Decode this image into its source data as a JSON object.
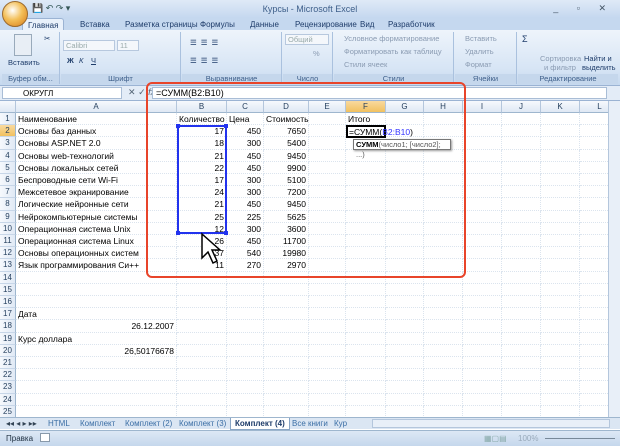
{
  "window": {
    "title": "Курсы - Microsoft Excel"
  },
  "ribbon_tabs": [
    "Главная",
    "Вставка",
    "Разметка страницы",
    "Формулы",
    "Данные",
    "Рецензирование",
    "Вид",
    "Разработчик"
  ],
  "ribbon": {
    "clipboard": {
      "paste": "Вставить",
      "label": "Буфер обм..."
    },
    "font": {
      "name": "Calibri",
      "size": "11",
      "bold": "Ж",
      "italic": "К",
      "underline": "Ч",
      "label": "Шрифт"
    },
    "alignment": {
      "label": "Выравнивание"
    },
    "number": {
      "format": "Общий",
      "percent": "%",
      "thousands": "000",
      "label": "Число"
    },
    "styles": {
      "conditional": "Условное форматирование",
      "as_table": "Форматировать как таблицу",
      "cell_styles": "Стили ячеек",
      "label": "Стили"
    },
    "cells": {
      "insert": "Вставить",
      "delete": "Удалить",
      "format": "Формат",
      "label": "Ячейки"
    },
    "editing": {
      "sigma": "Σ",
      "sort1": "Сортировка",
      "sort2": "и фильтр",
      "find1": "Найти и",
      "find2": "выделить",
      "label": "Редактирование"
    }
  },
  "formula_bar": {
    "name_box": "ОКРУГЛ",
    "cancel": "✕",
    "enter": "✓",
    "fx": "fx",
    "formula": "=СУММ(B2:B10)"
  },
  "columns": [
    "A",
    "B",
    "C",
    "D",
    "E",
    "F",
    "G",
    "H",
    "I",
    "J",
    "K",
    "L"
  ],
  "selected_column": "F",
  "selected_row": 2,
  "rows": [
    {
      "n": 1,
      "A": "Наименование",
      "B": "Количество",
      "C": "Цена",
      "D": "Стоимость",
      "F": "Итого"
    },
    {
      "n": 2,
      "A": "Основы баз данных",
      "B": "17",
      "C": "450",
      "D": "7650"
    },
    {
      "n": 3,
      "A": "Основы ASP.NET 2.0",
      "B": "18",
      "C": "300",
      "D": "5400"
    },
    {
      "n": 4,
      "A": "Основы web-технологий",
      "B": "21",
      "C": "450",
      "D": "9450"
    },
    {
      "n": 5,
      "A": "Основы локальных сетей",
      "B": "22",
      "C": "450",
      "D": "9900"
    },
    {
      "n": 6,
      "A": "Беспроводные сети Wi-Fi",
      "B": "17",
      "C": "300",
      "D": "5100"
    },
    {
      "n": 7,
      "A": "Межсетевое экранирование",
      "B": "24",
      "C": "300",
      "D": "7200"
    },
    {
      "n": 8,
      "A": "Логические нейронные сети",
      "B": "21",
      "C": "450",
      "D": "9450"
    },
    {
      "n": 9,
      "A": "Нейрокомпьютерные системы",
      "B": "25",
      "C": "225",
      "D": "5625"
    },
    {
      "n": 10,
      "A": "Операционная система Unix",
      "B": "12",
      "C": "300",
      "D": "3600"
    },
    {
      "n": 11,
      "A": "Операционная система Linux",
      "B": "26",
      "C": "450",
      "D": "11700"
    },
    {
      "n": 12,
      "A": "Основы операционных систем",
      "B": "37",
      "C": "540",
      "D": "19980"
    },
    {
      "n": 13,
      "A": "Язык программирования Си++",
      "B": "11",
      "C": "270",
      "D": "2970"
    },
    {
      "n": 14
    },
    {
      "n": 15
    },
    {
      "n": 16
    },
    {
      "n": 17,
      "A": "Дата"
    },
    {
      "n": 18,
      "A": "26.12.2007",
      "A_num": true
    },
    {
      "n": 19,
      "A": "Курс доллара"
    },
    {
      "n": 20,
      "A": "26,50176678",
      "A_num": true
    },
    {
      "n": 21
    },
    {
      "n": 22
    },
    {
      "n": 23
    },
    {
      "n": 24
    },
    {
      "n": 25
    },
    {
      "n": 26
    }
  ],
  "active_cell": {
    "ref": "F2",
    "prefix": "=СУММ(",
    "range": "B2:B10",
    "suffix": ")"
  },
  "tooltip": {
    "func": "СУММ",
    "args": "(число1; [число2]; ...)"
  },
  "sheet_tabs": [
    "HTML",
    "Комплект",
    "Комплект (2)",
    "Комплект (3)",
    "Комплект (4)",
    "Все книги",
    "Кур"
  ],
  "active_sheet": "Комплект (4)",
  "status": {
    "mode": "Правка",
    "zoom": "100%"
  },
  "colors": {
    "selection": "#2233ee",
    "highlight_frame": "#e8442a",
    "range_ref": "#3333ff"
  }
}
